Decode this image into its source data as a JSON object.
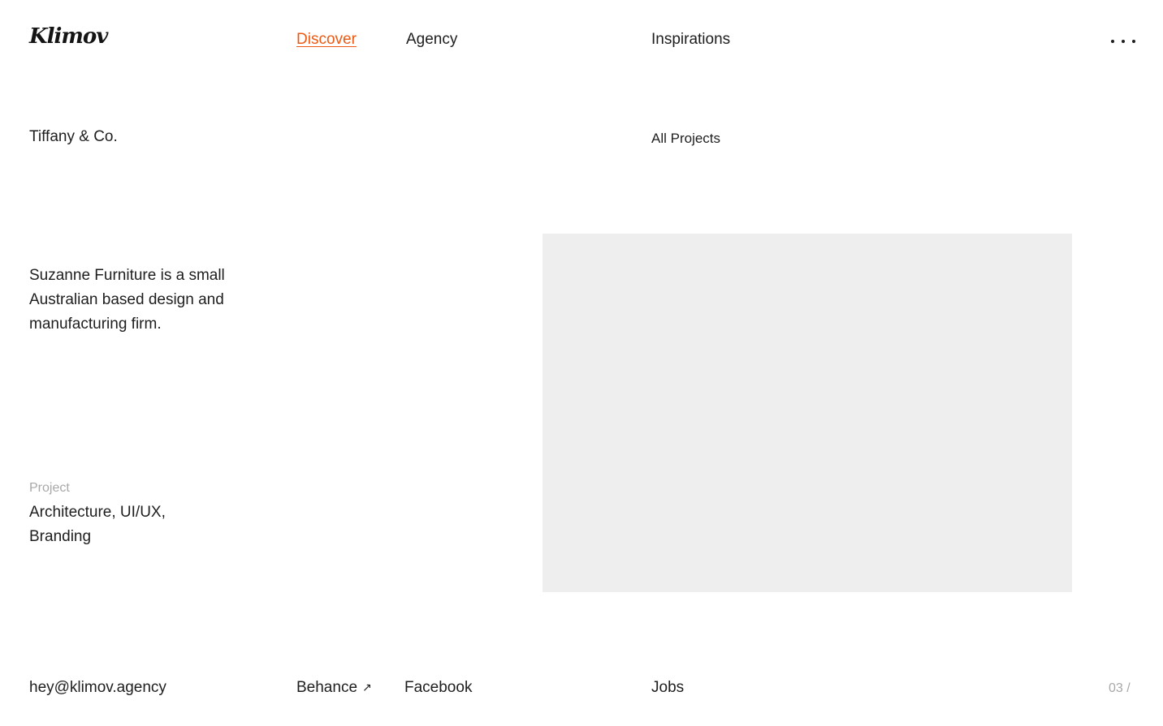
{
  "header": {
    "logo": "Klimov",
    "nav": {
      "discover": "Discover",
      "agency": "Agency",
      "inspirations": "Inspirations"
    },
    "menu_icon": "more-dots-icon"
  },
  "project": {
    "client": "Tiffany & Co.",
    "all_projects_label": "All Projects",
    "description": "Suzanne Furniture is a small Australian based design and manufacturing firm.",
    "category_label": "Project",
    "categories": "Architecture, UI/UX, Branding"
  },
  "footer": {
    "email": "hey@klimov.agency",
    "behance": "Behance",
    "behance_icon_glyph": "↗",
    "facebook": "Facebook",
    "jobs": "Jobs",
    "page_counter": "03 /"
  },
  "colors": {
    "accent": "#ea5a14",
    "text": "#1e1e1e",
    "muted": "#a8a8a8",
    "placeholder": "#eeeeee"
  }
}
